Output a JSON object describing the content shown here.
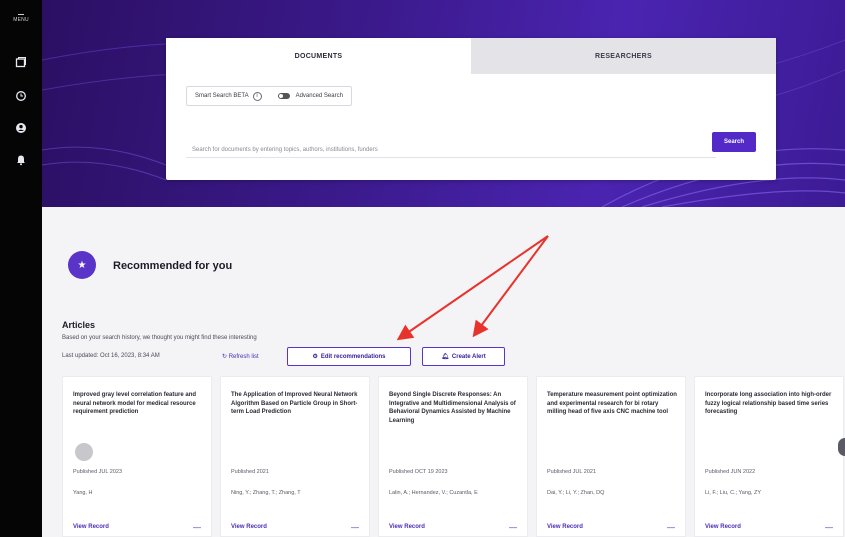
{
  "sidebar": {
    "menu_label": "MENU",
    "icons": [
      "documents-icon",
      "history-icon",
      "account-icon",
      "notifications-icon"
    ]
  },
  "search": {
    "tabs": [
      {
        "label": "DOCUMENTS",
        "active": true
      },
      {
        "label": "RESEARCHERS",
        "active": false
      }
    ],
    "smart_search_label": "Smart Search BETA",
    "advanced_search_label": "Advanced Search",
    "placeholder": "Search for documents by entering topics, authors, institutions, funders",
    "button_label": "Search"
  },
  "recommended": {
    "title": "Recommended for you",
    "section_heading": "Articles",
    "subtitle": "Based on your search history, we thought you might find these interesting",
    "last_updated": "Last updated: Oct 16, 2023, 8:34 AM",
    "refresh_label": "Refresh list",
    "edit_label": "Edit recommendations",
    "alert_label": "Create Alert"
  },
  "articles": [
    {
      "title": "Improved gray level correlation feature and neural network model for medical resource requirement prediction",
      "published": "Published JUL 2023",
      "authors": "Yang, H",
      "view_label": "View Record",
      "has_avatar": true
    },
    {
      "title": "The Application of Improved Neural Network Algorithm Based on Particle Group in Short-term Load Prediction",
      "published": "Published 2021",
      "authors": "Ning, Y.; Zhang, T.; Zhang, T",
      "view_label": "View Record",
      "has_avatar": false
    },
    {
      "title": "Beyond Single Discrete Responses: An Integrative and Multidimensional Analysis of Behavioral Dynamics Assisted by Machine Learning",
      "published": "Published OCT 19 2023",
      "authors": "Lalin, A.; Hernandez, V.; Cuzantla, E",
      "view_label": "View Record",
      "has_avatar": false
    },
    {
      "title": "Temperature measurement point optimization and experimental research for bi rotary milling head of five axis CNC machine tool",
      "published": "Published JUL 2021",
      "authors": "Dai, Y.; Li, Y.; Zhan, DQ",
      "view_label": "View Record",
      "has_avatar": false
    },
    {
      "title": "Incorporate long association into high-order fuzzy logical relationship based time series forecasting",
      "published": "Published JUN 2022",
      "authors": "Li, F.; Liu, C.; Yang, ZY",
      "view_label": "View Record",
      "has_avatar": false
    }
  ],
  "colors": {
    "brand": "#5329c8",
    "hero_dark": "#2b0f63",
    "annotation_arrow": "#e8322c"
  }
}
